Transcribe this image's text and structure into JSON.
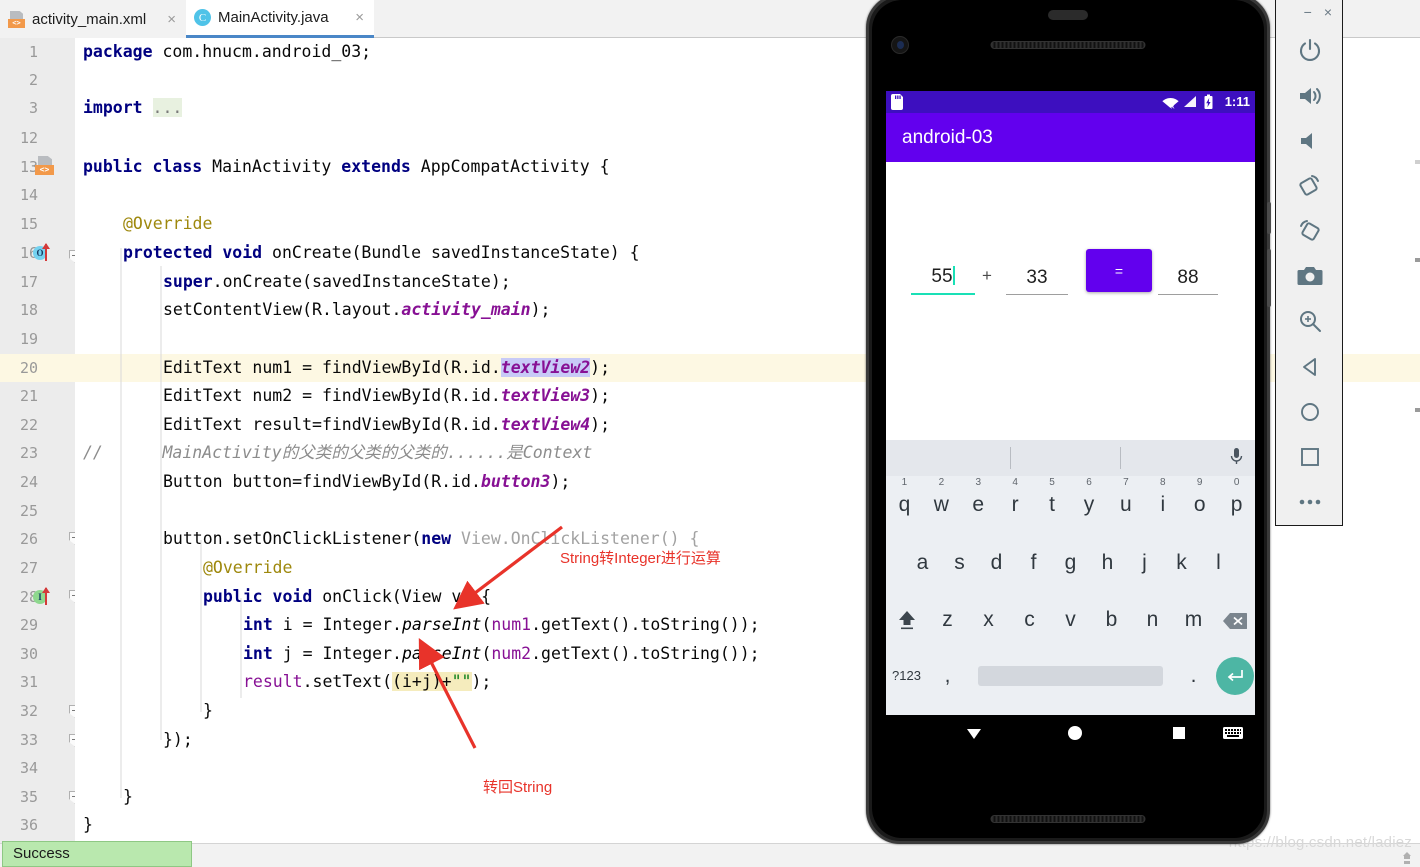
{
  "ide": {
    "tabs": [
      {
        "label": "activity_main.xml",
        "icon": "xml-file-icon",
        "active": false,
        "close": "×"
      },
      {
        "label": "MainActivity.java",
        "icon": "java-class-icon",
        "active": true,
        "close": "×"
      }
    ],
    "current_line": 20,
    "gutter_lines": [
      "1",
      "2",
      "3",
      "12",
      "13",
      "14",
      "15",
      "16",
      "17",
      "18",
      "19",
      "20",
      "21",
      "22",
      "23",
      "24",
      "25",
      "26",
      "27",
      "28",
      "29",
      "30",
      "31",
      "32",
      "33",
      "34",
      "35",
      "36"
    ],
    "code": {
      "l1_kw": "package",
      "l1_rest": " com.hnucm.android_03;",
      "l3_kw": "import",
      "l3_dots": "...",
      "l13_a": "public",
      "l13_b": "class",
      "l13_c": " MainActivity ",
      "l13_d": "extends",
      "l13_e": " AppCompatActivity {",
      "l15": "@Override",
      "l16_a": "protected",
      "l16_b": "void",
      "l16_c": " onCreate(Bundle savedInstanceState) {",
      "l17_a": "super",
      "l17_b": ".onCreate(savedInstanceState);",
      "l18_a": "setContentView(R.layout.",
      "l18_b": "activity_main",
      "l18_c": ");",
      "l20_a": "EditText num1 = findViewById(R.id.",
      "l20_b": "textView2",
      "l20_c": ");",
      "l21_a": "EditText num2 = findViewById(R.id.",
      "l21_b": "textView3",
      "l21_c": ");",
      "l22_a": "EditText result=findViewById(R.id.",
      "l22_b": "textView4",
      "l22_c": ");",
      "l23_slash": "//",
      "l23_text": "MainActivity的父类的父类的父类的......是Context",
      "l24_a": "Button button=findViewById(R.id.",
      "l24_b": "button3",
      "l24_c": ");",
      "l26_a": "button.setOnClickListener(",
      "l26_b": "new",
      "l26_c": " View.OnClickListener() {",
      "l27": "@Override",
      "l28_a": "public",
      "l28_b": "void",
      "l28_c": " onClick(View v) {",
      "l29_a": "int",
      "l29_b": " i = Integer.",
      "l29_c": "parseInt",
      "l29_d": "(",
      "l29_e": "num1",
      "l29_f": ".getText().toString());",
      "l30_a": "int",
      "l30_b": " j = Integer.",
      "l30_c": "parseInt",
      "l30_d": "(",
      "l30_e": "num2",
      "l30_f": ".getText().toString());",
      "l31_a": "result",
      "l31_b": ".setText(",
      "l31_hl_a": "(i+j)+",
      "l31_hl_b": "\"\"",
      "l31_c": ");",
      "l32": "}",
      "l33": "});",
      "l35": "}",
      "l36": "}"
    },
    "annotations": [
      {
        "text": "String转Integer进行运算",
        "name": "annotation-parse-int"
      },
      {
        "text": "转回String",
        "name": "annotation-back-to-string"
      }
    ],
    "toast": "Success",
    "watermark": "https://blog.csdn.net/ladiez"
  },
  "emulator": {
    "window_controls": {
      "minimize": "−",
      "close": "×"
    },
    "toolbar_buttons": [
      {
        "name": "power-button",
        "label": "Power"
      },
      {
        "name": "volume-up-button",
        "label": "Volume Up"
      },
      {
        "name": "volume-down-button",
        "label": "Volume Down"
      },
      {
        "name": "rotate-left-button",
        "label": "Rotate Left"
      },
      {
        "name": "rotate-right-button",
        "label": "Rotate Right"
      },
      {
        "name": "screenshot-button",
        "label": "Take Screenshot"
      },
      {
        "name": "zoom-button",
        "label": "Enter zoom mode"
      },
      {
        "name": "back-button",
        "label": "Back"
      },
      {
        "name": "home-button",
        "label": "Home"
      },
      {
        "name": "overview-button",
        "label": "Overview"
      },
      {
        "name": "more-button",
        "label": "More"
      }
    ],
    "device": {
      "status_bar": {
        "time": "1:11",
        "sdcard_icon": "sdcard-icon",
        "wifi_icon": "wifi-off-icon",
        "signal_icon": "cellular-signal-icon",
        "battery_icon": "battery-charging-icon"
      },
      "app_bar_title": "android-03",
      "calculator": {
        "num1": "55",
        "operator": "+",
        "num2": "33",
        "equals_label": "=",
        "result": "88"
      },
      "keyboard": {
        "row1": [
          {
            "key": "q",
            "sup": "1"
          },
          {
            "key": "w",
            "sup": "2"
          },
          {
            "key": "e",
            "sup": "3"
          },
          {
            "key": "r",
            "sup": "4"
          },
          {
            "key": "t",
            "sup": "5"
          },
          {
            "key": "y",
            "sup": "6"
          },
          {
            "key": "u",
            "sup": "7"
          },
          {
            "key": "i",
            "sup": "8"
          },
          {
            "key": "o",
            "sup": "9"
          },
          {
            "key": "p",
            "sup": "0"
          }
        ],
        "row2": [
          "a",
          "s",
          "d",
          "f",
          "g",
          "h",
          "j",
          "k",
          "l"
        ],
        "row3": [
          "z",
          "x",
          "c",
          "v",
          "b",
          "n",
          "m"
        ],
        "shift_icon": "shift-icon",
        "backspace_icon": "backspace-icon",
        "symbols_key": "?123",
        "comma_key": ",",
        "period_key": ".",
        "enter_icon": "enter-icon",
        "mic_icon": "microphone-icon"
      },
      "navbar": {
        "back_icon": "nav-back-icon",
        "home_icon": "nav-home-icon",
        "recents_icon": "nav-recents-icon",
        "keyboard_icon": "nav-keyboard-icon"
      }
    }
  },
  "colors": {
    "accent_purple": "#6200ee",
    "status_purple": "#3d0fbf",
    "teal": "#19e0b6",
    "annotation_red": "#e8332a",
    "success_green": "#b9e8ae",
    "highlight_line": "#fdf8e3"
  }
}
